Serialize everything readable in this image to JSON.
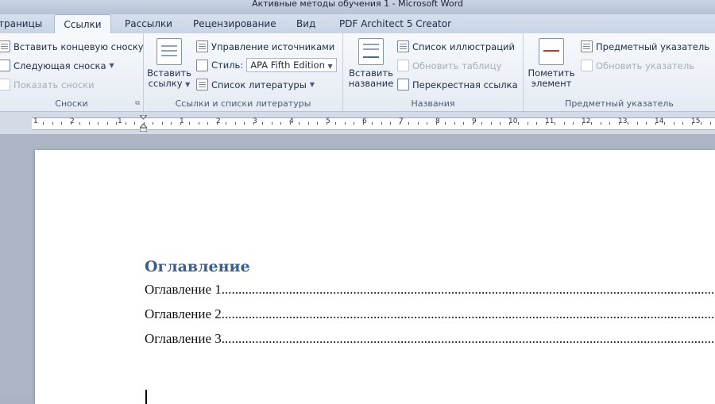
{
  "window": {
    "title": "Активные методы обучения 1  -  Microsoft Word"
  },
  "tabs": [
    "траницы",
    "Ссылки",
    "Рассылки",
    "Рецензирование",
    "Вид",
    "PDF Architect 5 Creator"
  ],
  "ribbon": {
    "footnotes": {
      "label": "Сноски",
      "insert_endnote": "Вставить концевую сноску",
      "next_footnote": "Следующая сноска",
      "show_notes": "Показать сноски"
    },
    "citations": {
      "label": "Ссылки и списки литературы",
      "insert_citation_l1": "Вставить",
      "insert_citation_l2": "ссылку",
      "manage_sources": "Управление источниками",
      "style_label": "Стиль:",
      "style_value": "APA Fifth Edition",
      "bibliography": "Список литературы"
    },
    "captions": {
      "label": "Названия",
      "insert_caption_l1": "Вставить",
      "insert_caption_l2": "название",
      "table_of_figures": "Список иллюстраций",
      "update_table": "Обновить таблицу",
      "cross_reference": "Перекрестная ссылка"
    },
    "index": {
      "label": "Предметный указатель",
      "mark_entry_l1": "Пометить",
      "mark_entry_l2": "элемент",
      "insert_index": "Предметный указатель",
      "update_index": "Обновить указатель"
    }
  },
  "ruler": {
    "numbers": [
      "1",
      "2",
      "1",
      "1",
      "2",
      "3",
      "4",
      "5",
      "6",
      "7",
      "8",
      "9",
      "10",
      "11",
      "12",
      "13",
      "14",
      "15"
    ]
  },
  "document": {
    "toc_title": "Оглавление",
    "entries": [
      "Оглавление 1.......................................................................................................................................................",
      "Оглавление 2.......................................................................................................................................................",
      "Оглавление 3......................................................................................................................................................."
    ]
  }
}
